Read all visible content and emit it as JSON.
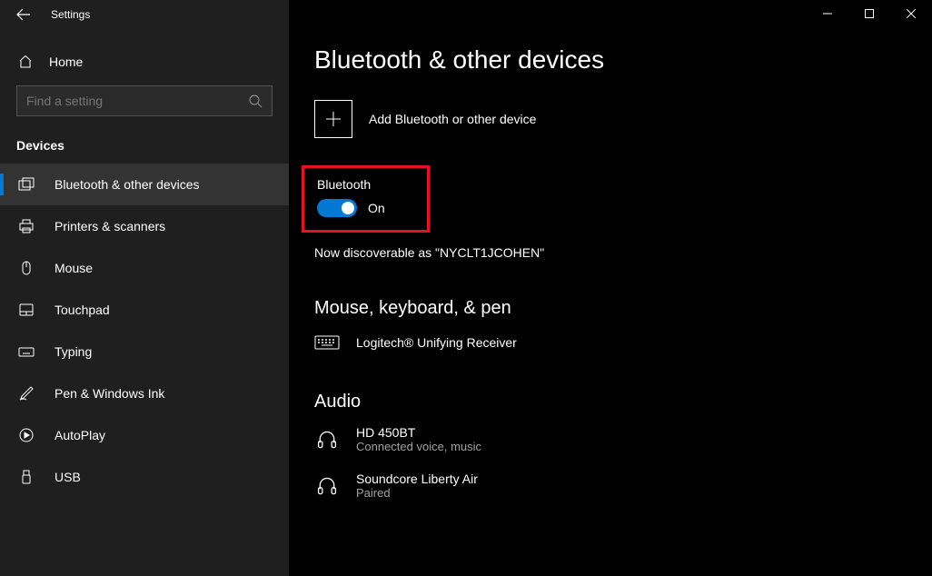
{
  "window": {
    "title": "Settings"
  },
  "sidebar": {
    "home_label": "Home",
    "search_placeholder": "Find a setting",
    "section_title": "Devices",
    "items": [
      {
        "label": "Bluetooth & other devices"
      },
      {
        "label": "Printers & scanners"
      },
      {
        "label": "Mouse"
      },
      {
        "label": "Touchpad"
      },
      {
        "label": "Typing"
      },
      {
        "label": "Pen & Windows Ink"
      },
      {
        "label": "AutoPlay"
      },
      {
        "label": "USB"
      }
    ]
  },
  "main": {
    "page_title": "Bluetooth & other devices",
    "add_device_label": "Add Bluetooth or other device",
    "bluetooth": {
      "label": "Bluetooth",
      "state_label": "On",
      "discoverable_text": "Now discoverable as \"NYCLT1JCOHEN\""
    },
    "sections": [
      {
        "title": "Mouse, keyboard, & pen",
        "devices": [
          {
            "name": "Logitech® Unifying Receiver",
            "status": ""
          }
        ]
      },
      {
        "title": "Audio",
        "devices": [
          {
            "name": "HD 450BT",
            "status": "Connected voice, music"
          },
          {
            "name": "Soundcore Liberty Air",
            "status": "Paired"
          }
        ]
      }
    ]
  }
}
